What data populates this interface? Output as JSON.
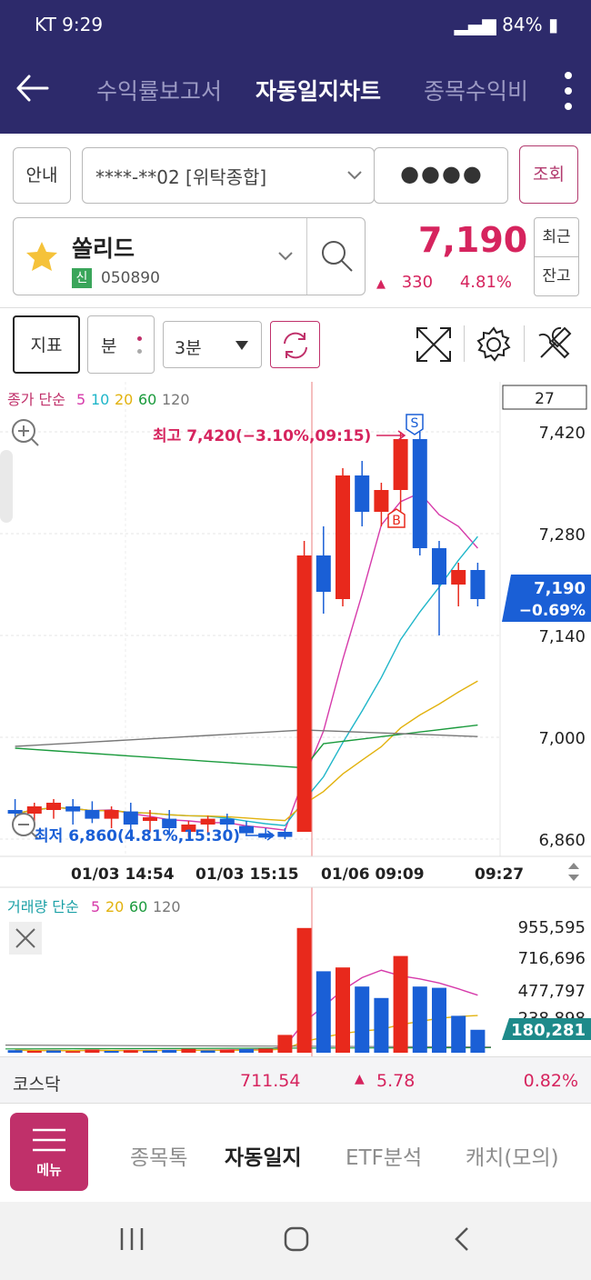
{
  "status": {
    "carrier": "KT",
    "time": "9:29",
    "battery": "84%"
  },
  "header": {
    "tabs": [
      {
        "label": "수익률보고서"
      },
      {
        "label": "자동일지차트"
      },
      {
        "label": "종목수익비"
      }
    ]
  },
  "account": {
    "guide_label": "안내",
    "account_value": "****-**02 [위탁종합]",
    "password_mask": "●●●●",
    "query_label": "조회"
  },
  "stock": {
    "name": "쏠리드",
    "credit_badge": "신",
    "code": "050890",
    "price": "7,190",
    "change": "330",
    "change_pct": "4.81%",
    "recent_label": "최근",
    "balance_label": "잔고"
  },
  "toolbar": {
    "indicator_label": "지표",
    "unit_label": "분",
    "interval_value": "3분"
  },
  "chart": {
    "legend_prefix": "종가 단순",
    "ma_labels": [
      "5",
      "10",
      "20",
      "60",
      "120"
    ],
    "count_box": "27",
    "high_annotation": "최고 7,420(−3.10%,09:15)",
    "low_annotation": "최저 6,860(4.81%,15:30)",
    "price_ticks": [
      "7,420",
      "7,280",
      "7,140",
      "7,000",
      "6,860"
    ],
    "current_price": "7,190",
    "current_pct": "−0.69%",
    "marker_s": "S",
    "marker_b": "B",
    "time_labels": [
      "01/03 14:54",
      "01/03 15:15",
      "01/06 09:09",
      "09:27"
    ],
    "volume_legend_prefix": "거래량 단순",
    "volume_ma_labels": [
      "5",
      "20",
      "60",
      "120"
    ],
    "volume_ticks": [
      "955,595",
      "716,696",
      "477,797",
      "238,898"
    ],
    "current_volume": "180,281",
    "colors": {
      "up": "#e8291c",
      "down": "#1a5fd6",
      "ma5": "#d63aaa",
      "ma10": "#1fb6c9",
      "ma20": "#e2b20e",
      "ma60": "#1a9a3c",
      "ma120": "#777777"
    }
  },
  "chart_data": {
    "type": "candlestick",
    "unit": "price (KRW)",
    "ylim": [
      6860,
      7420
    ],
    "candles": [
      {
        "o": 6900,
        "h": 6915,
        "l": 6885,
        "c": 6895
      },
      {
        "o": 6895,
        "h": 6910,
        "l": 6880,
        "c": 6905
      },
      {
        "o": 6900,
        "h": 6915,
        "l": 6888,
        "c": 6910
      },
      {
        "o": 6905,
        "h": 6915,
        "l": 6880,
        "c": 6898
      },
      {
        "o": 6900,
        "h": 6912,
        "l": 6882,
        "c": 6888
      },
      {
        "o": 6888,
        "h": 6905,
        "l": 6875,
        "c": 6900
      },
      {
        "o": 6898,
        "h": 6910,
        "l": 6870,
        "c": 6880
      },
      {
        "o": 6885,
        "h": 6900,
        "l": 6870,
        "c": 6890
      },
      {
        "o": 6888,
        "h": 6900,
        "l": 6865,
        "c": 6875
      },
      {
        "o": 6870,
        "h": 6885,
        "l": 6862,
        "c": 6880
      },
      {
        "o": 6880,
        "h": 6892,
        "l": 6868,
        "c": 6888
      },
      {
        "o": 6888,
        "h": 6895,
        "l": 6872,
        "c": 6880
      },
      {
        "o": 6878,
        "h": 6885,
        "l": 6865,
        "c": 6868
      },
      {
        "o": 6868,
        "h": 6875,
        "l": 6860,
        "c": 6862
      },
      {
        "o": 6870,
        "h": 6875,
        "l": 6860,
        "c": 6863
      },
      {
        "o": 6870,
        "h": 7270,
        "l": 6900,
        "c": 7250
      },
      {
        "o": 7250,
        "h": 7290,
        "l": 7170,
        "c": 7200
      },
      {
        "o": 7190,
        "h": 7370,
        "l": 7180,
        "c": 7360
      },
      {
        "o": 7360,
        "h": 7380,
        "l": 7290,
        "c": 7310
      },
      {
        "o": 7310,
        "h": 7350,
        "l": 7290,
        "c": 7340
      },
      {
        "o": 7340,
        "h": 7420,
        "l": 7290,
        "c": 7410
      },
      {
        "o": 7410,
        "h": 7420,
        "l": 7250,
        "c": 7260
      },
      {
        "o": 7260,
        "h": 7270,
        "l": 7140,
        "c": 7210
      },
      {
        "o": 7210,
        "h": 7240,
        "l": 7180,
        "c": 7230
      },
      {
        "o": 7230,
        "h": 7240,
        "l": 7180,
        "c": 7190
      }
    ],
    "volume_ylim": [
      0,
      1000000
    ],
    "volumes": [
      {
        "v": 20000,
        "up": false
      },
      {
        "v": 15000,
        "up": true
      },
      {
        "v": 18000,
        "up": false
      },
      {
        "v": 12000,
        "up": true
      },
      {
        "v": 25000,
        "up": true
      },
      {
        "v": 14000,
        "up": false
      },
      {
        "v": 20000,
        "up": true
      },
      {
        "v": 16000,
        "up": false
      },
      {
        "v": 22000,
        "up": false
      },
      {
        "v": 30000,
        "up": true
      },
      {
        "v": 18000,
        "up": false
      },
      {
        "v": 24000,
        "up": true
      },
      {
        "v": 28000,
        "up": false
      },
      {
        "v": 32000,
        "up": true
      },
      {
        "v": 140000,
        "up": true
      },
      {
        "v": 980000,
        "up": true
      },
      {
        "v": 640000,
        "up": false
      },
      {
        "v": 670000,
        "up": true
      },
      {
        "v": 520000,
        "up": false
      },
      {
        "v": 430000,
        "up": false
      },
      {
        "v": 760000,
        "up": true
      },
      {
        "v": 520000,
        "up": false
      },
      {
        "v": 510000,
        "up": false
      },
      {
        "v": 290000,
        "up": false
      },
      {
        "v": 180281,
        "up": false
      }
    ]
  },
  "market": {
    "name": "코스닥",
    "value": "711.54",
    "change": "5.78",
    "change_pct": "0.82%"
  },
  "bottom_nav": {
    "menu_label": "메뉴",
    "items": [
      {
        "label": "종목톡"
      },
      {
        "label": "자동일지"
      },
      {
        "label": "ETF분석"
      },
      {
        "label": "캐치(모의)"
      }
    ]
  }
}
